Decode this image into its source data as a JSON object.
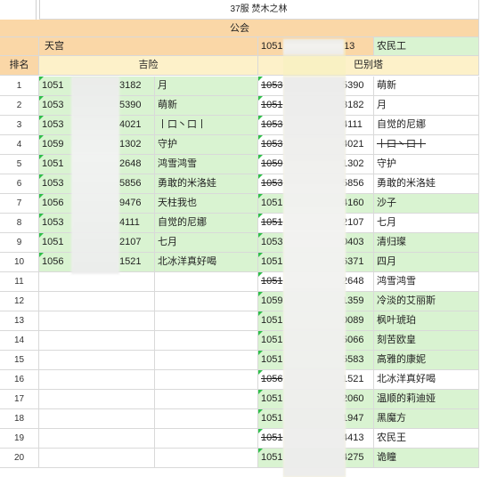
{
  "sheet": {
    "title": "37服 焚木之林",
    "header_guild": "公会",
    "left_team": "天宫",
    "right_team_id": "1051",
    "right_team_id_suffix": "13",
    "right_team_name": "农民工",
    "rank_label": "排名",
    "left_group": "吉险",
    "right_group": "巴别塔"
  },
  "rows": [
    {
      "n": "1",
      "lid_a": "1051",
      "lid_b": "3182",
      "lname": "月",
      "rid_a": "1053",
      "rid_b": "5390",
      "rname": "萌新",
      "rstrike": true,
      "rgreen": false
    },
    {
      "n": "2",
      "lid_a": "1053",
      "lid_b": "5390",
      "lname": "萌新",
      "rid_a": "1051",
      "rid_b": "3182",
      "rname": "月",
      "rstrike": true,
      "rgreen": false
    },
    {
      "n": "3",
      "lid_a": "1053",
      "lid_b": "4021",
      "lname": "丨口丶口丨",
      "rid_a": "1053",
      "rid_b": "4111",
      "rname": "自觉的尼娜",
      "rstrike": true,
      "rgreen": false
    },
    {
      "n": "4",
      "lid_a": "1059",
      "lid_b": "1302",
      "lname": "守护",
      "rid_a": "1053",
      "rid_b": "4021",
      "rname": "丨口丶口丨",
      "rstrike": true,
      "rgreen": false,
      "rnamestrike": true
    },
    {
      "n": "5",
      "lid_a": "1051",
      "lid_b": "2648",
      "lname": "鸿雪鸿雪",
      "rid_a": "1059",
      "rid_b": "1302",
      "rname": "守护",
      "rstrike": true,
      "rgreen": false
    },
    {
      "n": "6",
      "lid_a": "1053",
      "lid_b": "5856",
      "lname": "勇敢的米洛娃",
      "rid_a": "1053",
      "rid_b": "5856",
      "rname": "勇敢的米洛娃",
      "rstrike": true,
      "rgreen": false
    },
    {
      "n": "7",
      "lid_a": "1056",
      "lid_b": "9476",
      "lname": "天柱我也",
      "rid_a": "1051",
      "rid_b": "4160",
      "rname": "沙子",
      "rstrike": false,
      "rgreen": true
    },
    {
      "n": "8",
      "lid_a": "1053",
      "lid_b": "4111",
      "lname": "自觉的尼娜",
      "rid_a": "1051",
      "rid_b": "2107",
      "rname": "七月",
      "rstrike": true,
      "rgreen": false
    },
    {
      "n": "9",
      "lid_a": "1051",
      "lid_b": "2107",
      "lname": "七月",
      "rid_a": "1053",
      "rid_b": "0403",
      "rname": "清归璨",
      "rstrike": false,
      "rgreen": true
    },
    {
      "n": "10",
      "lid_a": "1056",
      "lid_b": "1521",
      "lname": "北冰洋真好喝",
      "rid_a": "1051",
      "rid_b": "6371",
      "rname": "四月",
      "rstrike": false,
      "rgreen": true
    },
    {
      "n": "11",
      "rid_a": "1051",
      "rid_b": "2648",
      "rname": "鸿雪鸿雪",
      "rstrike": true,
      "rgreen": false
    },
    {
      "n": "12",
      "rid_a": "1059",
      "rid_b": "1359",
      "rname": "冷淡的艾丽斯",
      "rstrike": false,
      "rgreen": true
    },
    {
      "n": "13",
      "rid_a": "1051",
      "rid_b": "0089",
      "rname": "枫叶琥珀",
      "rstrike": false,
      "rgreen": true
    },
    {
      "n": "14",
      "rid_a": "1051",
      "rid_b": "5066",
      "rname": "刻苦欧皇",
      "rstrike": false,
      "rgreen": true
    },
    {
      "n": "15",
      "rid_a": "1051",
      "rid_b": "5583",
      "rname": "高雅的康妮",
      "rstrike": false,
      "rgreen": true
    },
    {
      "n": "16",
      "rid_a": "1056",
      "rid_b": "1521",
      "rname": "北冰洋真好喝",
      "rstrike": true,
      "rgreen": false
    },
    {
      "n": "17",
      "rid_a": "1051",
      "rid_b": "2060",
      "rname": "温顺的莉迪娅",
      "rstrike": false,
      "rgreen": true
    },
    {
      "n": "18",
      "rid_a": "1051",
      "rid_b": "1947",
      "rname": "黑魔方",
      "rstrike": false,
      "rgreen": true
    },
    {
      "n": "19",
      "rid_a": "1051",
      "rid_b": "4413",
      "rname": "农民王",
      "rstrike": true,
      "rgreen": false
    },
    {
      "n": "20",
      "rid_a": "1051",
      "rid_b": "4275",
      "rname": "诡瞳",
      "rstrike": false,
      "rgreen": true
    }
  ]
}
